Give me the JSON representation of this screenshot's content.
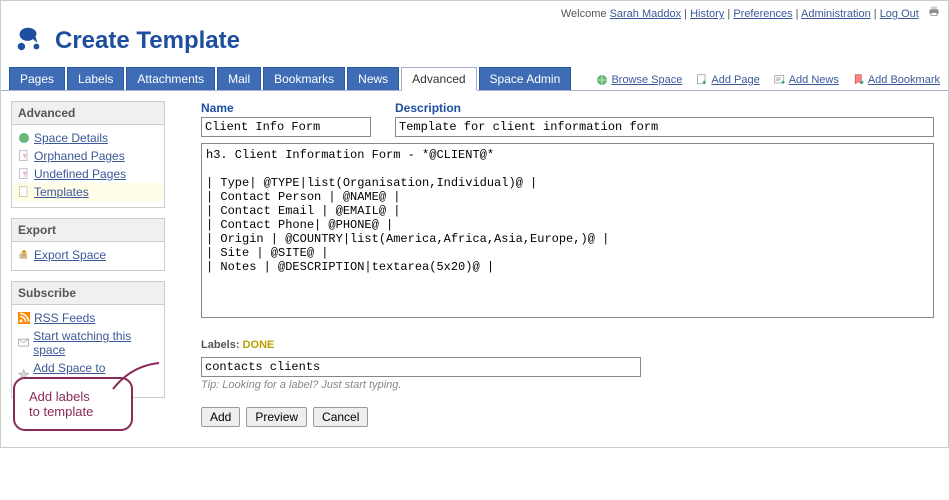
{
  "meta": {
    "welcome_prefix": "Welcome ",
    "user": "Sarah Maddox",
    "links": [
      "History",
      "Preferences",
      "Administration",
      "Log Out"
    ]
  },
  "header": {
    "title": "Create Template"
  },
  "tabs": [
    {
      "label": "Pages",
      "active": false
    },
    {
      "label": "Labels",
      "active": false
    },
    {
      "label": "Attachments",
      "active": false
    },
    {
      "label": "Mail",
      "active": false
    },
    {
      "label": "Bookmarks",
      "active": false
    },
    {
      "label": "News",
      "active": false
    },
    {
      "label": "Advanced",
      "active": true
    },
    {
      "label": "Space Admin",
      "active": false
    }
  ],
  "tab_actions": {
    "browse": "Browse Space",
    "add_page": "Add Page",
    "add_news": "Add News",
    "add_bookmark": "Add Bookmark"
  },
  "sidebar": {
    "advanced": {
      "title": "Advanced",
      "items": [
        {
          "label": "Space Details",
          "icon": "globe-icon",
          "selected": false
        },
        {
          "label": "Orphaned Pages",
          "icon": "page-question-icon",
          "selected": false
        },
        {
          "label": "Undefined Pages",
          "icon": "page-question-icon",
          "selected": false
        },
        {
          "label": "Templates",
          "icon": "page-icon",
          "selected": true
        }
      ]
    },
    "export": {
      "title": "Export",
      "items": [
        {
          "label": "Export Space",
          "icon": "export-icon"
        }
      ]
    },
    "subscribe": {
      "title": "Subscribe",
      "items": [
        {
          "label": "RSS Feeds",
          "icon": "rss-icon"
        },
        {
          "label": "Start watching this space",
          "icon": "mail-icon"
        },
        {
          "label": "Add Space to Favourites",
          "icon": "star-icon"
        }
      ]
    }
  },
  "form": {
    "name_label": "Name",
    "name_value": "Client Info Form",
    "desc_label": "Description",
    "desc_value": "Template for client information form",
    "content": "h3. Client Information Form - *@CLIENT@*\n\n| Type| @TYPE|list(Organisation,Individual)@ |\n| Contact Person | @NAME@ |\n| Contact Email | @EMAIL@ |\n| Contact Phone| @PHONE@ |\n| Origin | @COUNTRY|list(America,Africa,Asia,Europe,)@ |\n| Site | @SITE@ |\n| Notes | @DESCRIPTION|textarea(5x20)@ |",
    "labels_label": "Labels:",
    "labels_done": "DONE",
    "labels_value": "contacts clients",
    "tip_prefix": "Tip: ",
    "tip_text": "Looking for a label? Just start typing.",
    "buttons": {
      "add": "Add",
      "preview": "Preview",
      "cancel": "Cancel"
    }
  },
  "callout": {
    "line1": "Add labels",
    "line2": "to template"
  }
}
